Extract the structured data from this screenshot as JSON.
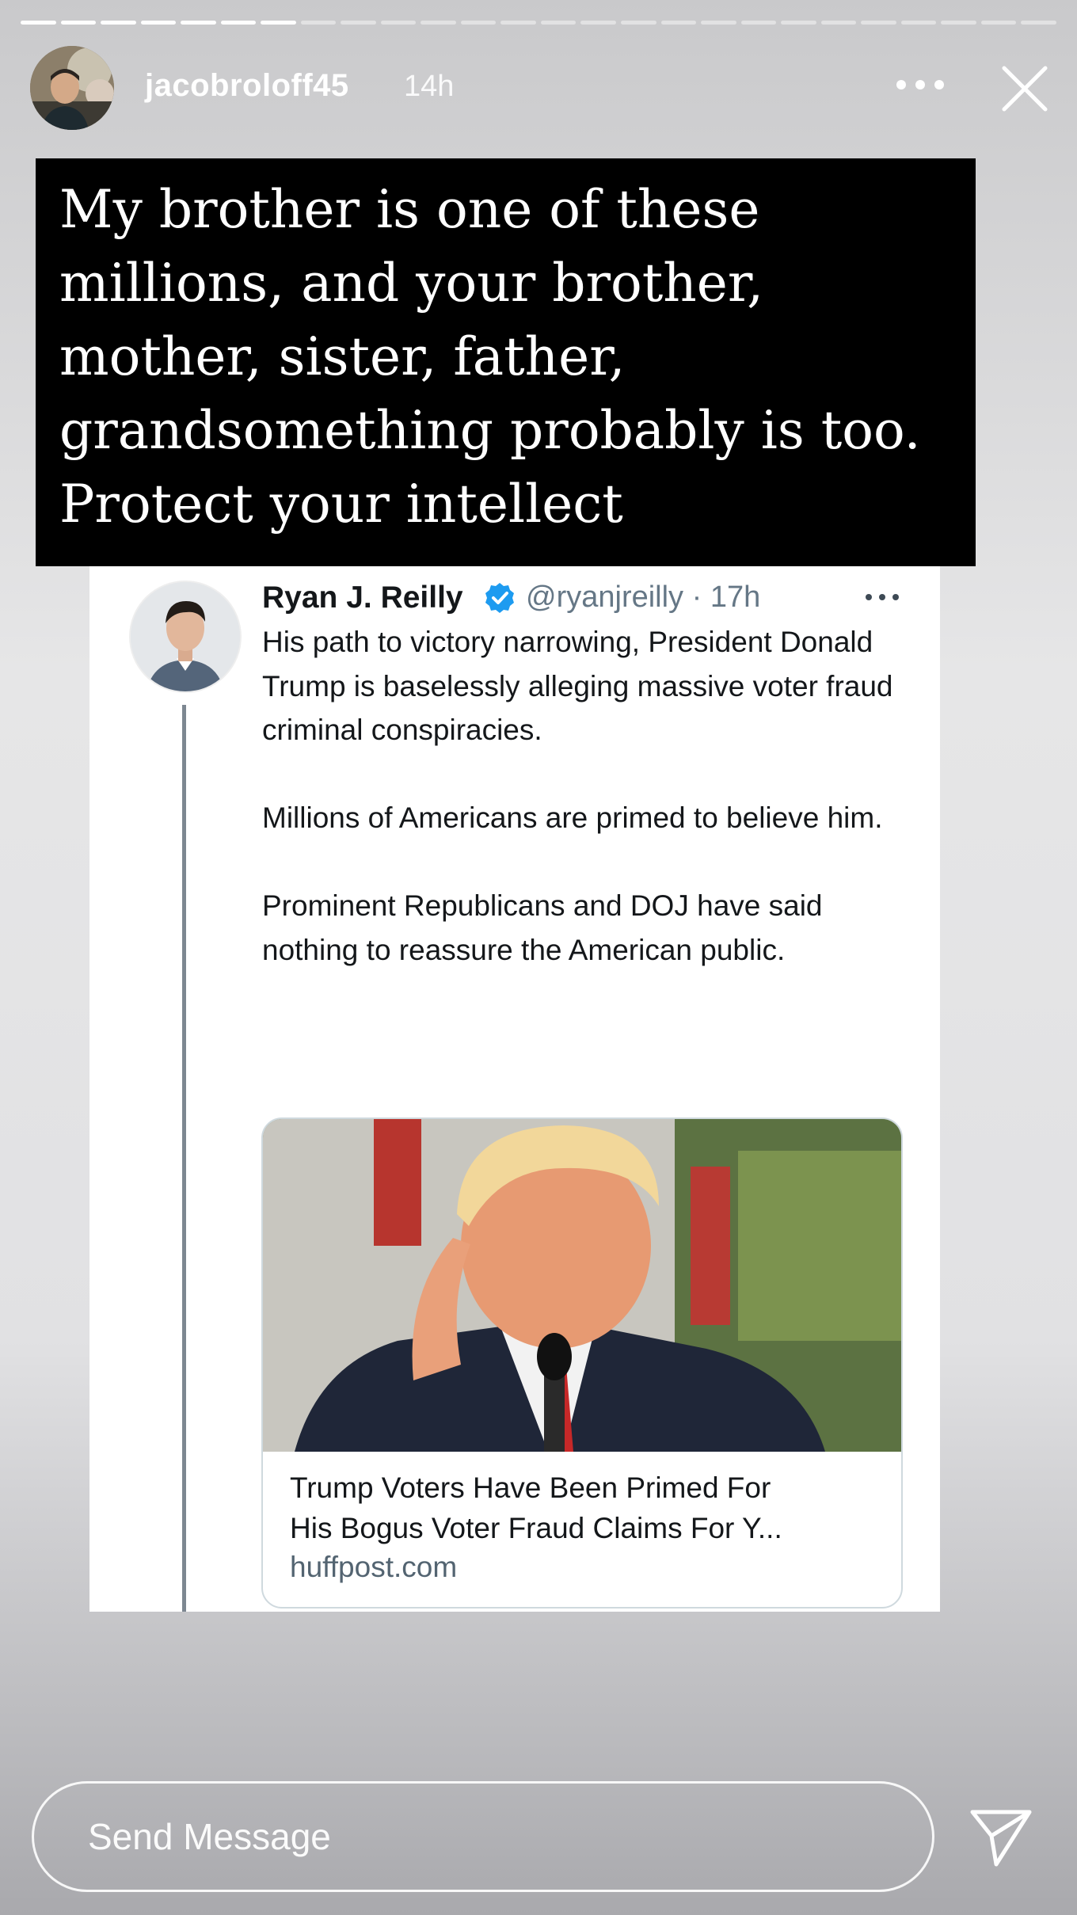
{
  "story": {
    "segments_total": 26,
    "segments_viewed": 7
  },
  "header": {
    "username": "jacobroloff45",
    "time": "14h",
    "more_icon": "more-horizontal-icon",
    "close_icon": "close-icon"
  },
  "caption": {
    "text": "My brother is one of these\nmillions, and your brother,\nmother, sister, father,\ngrandsomething  probably is too.\nProtect your intellect"
  },
  "tweet": {
    "name": "Ryan J. Reilly",
    "verified_icon": "verified-badge-icon",
    "handle_time": "@ryanjreilly · 17h",
    "paragraphs": [
      "His path to victory narrowing, President Donald Trump is baselessly alleging massive voter fraud criminal conspiracies.",
      "Millions of Americans are primed to believe him.",
      "Prominent Republicans and DOJ have said nothing to reassure the American public."
    ],
    "link_card": {
      "title": "Trump Voters Have Been Primed For\nHis Bogus Voter Fraud Claims For Y...",
      "domain": "huffpost.com"
    }
  },
  "footer": {
    "placeholder": "Send Message",
    "send_icon": "paper-plane-icon"
  },
  "colors": {
    "verified": "#1d9bf0",
    "caption_bg": "#000000",
    "handle": "#657786"
  }
}
